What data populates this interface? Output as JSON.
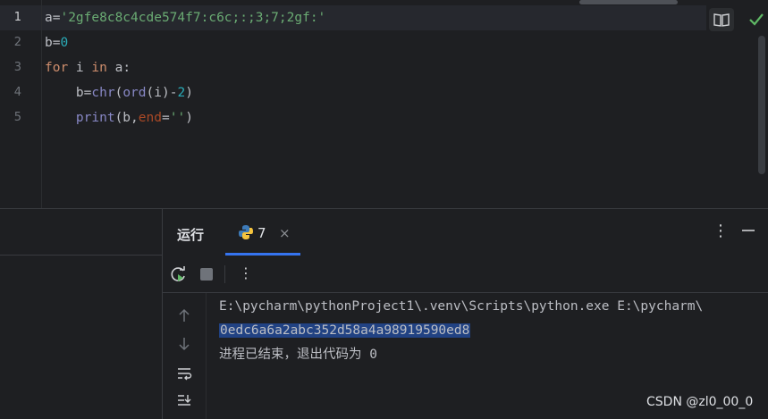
{
  "editor": {
    "line_numbers": [
      "1",
      "2",
      "3",
      "4",
      "5"
    ],
    "lines": [
      {
        "indent": "",
        "parts": [
          {
            "t": "a=",
            "c": ""
          },
          {
            "t": "'2gfe8c8c4cde574f7:c6c;:;3;7;2gf:'",
            "c": "str"
          }
        ]
      },
      {
        "indent": "",
        "parts": [
          {
            "t": "b=",
            "c": ""
          },
          {
            "t": "0",
            "c": "num"
          }
        ]
      },
      {
        "indent": "",
        "parts": [
          {
            "t": "for",
            "c": "kw"
          },
          {
            "t": " i ",
            "c": ""
          },
          {
            "t": "in",
            "c": "kw"
          },
          {
            "t": " a:",
            "c": ""
          }
        ]
      },
      {
        "indent": "    ",
        "parts": [
          {
            "t": "b=",
            "c": ""
          },
          {
            "t": "chr",
            "c": "bi"
          },
          {
            "t": "(",
            "c": ""
          },
          {
            "t": "ord",
            "c": "bi"
          },
          {
            "t": "(i)-",
            "c": ""
          },
          {
            "t": "2",
            "c": "num"
          },
          {
            "t": ")",
            "c": ""
          }
        ]
      },
      {
        "indent": "    ",
        "parts": [
          {
            "t": "print",
            "c": "bi"
          },
          {
            "t": "(b,",
            "c": ""
          },
          {
            "t": "end",
            "c": "named"
          },
          {
            "t": "=",
            "c": ""
          },
          {
            "t": "''",
            "c": "str"
          },
          {
            "t": ")",
            "c": ""
          }
        ]
      }
    ]
  },
  "run_panel": {
    "title": "运行",
    "tab_label": "7",
    "tab_close": "×",
    "more": "⋮"
  },
  "console": {
    "command": "E:\\pycharm\\pythonProject1\\.venv\\Scripts\\python.exe E:\\pycharm\\",
    "output": "0edc6a6a2abc352d58a4a98919590ed8",
    "exit": "进程已结束，退出代码为 0"
  },
  "watermark": "CSDN @zl0_00_0",
  "colors": {
    "accent": "#3574f0",
    "selection": "#214283",
    "check": "#5fb865"
  }
}
